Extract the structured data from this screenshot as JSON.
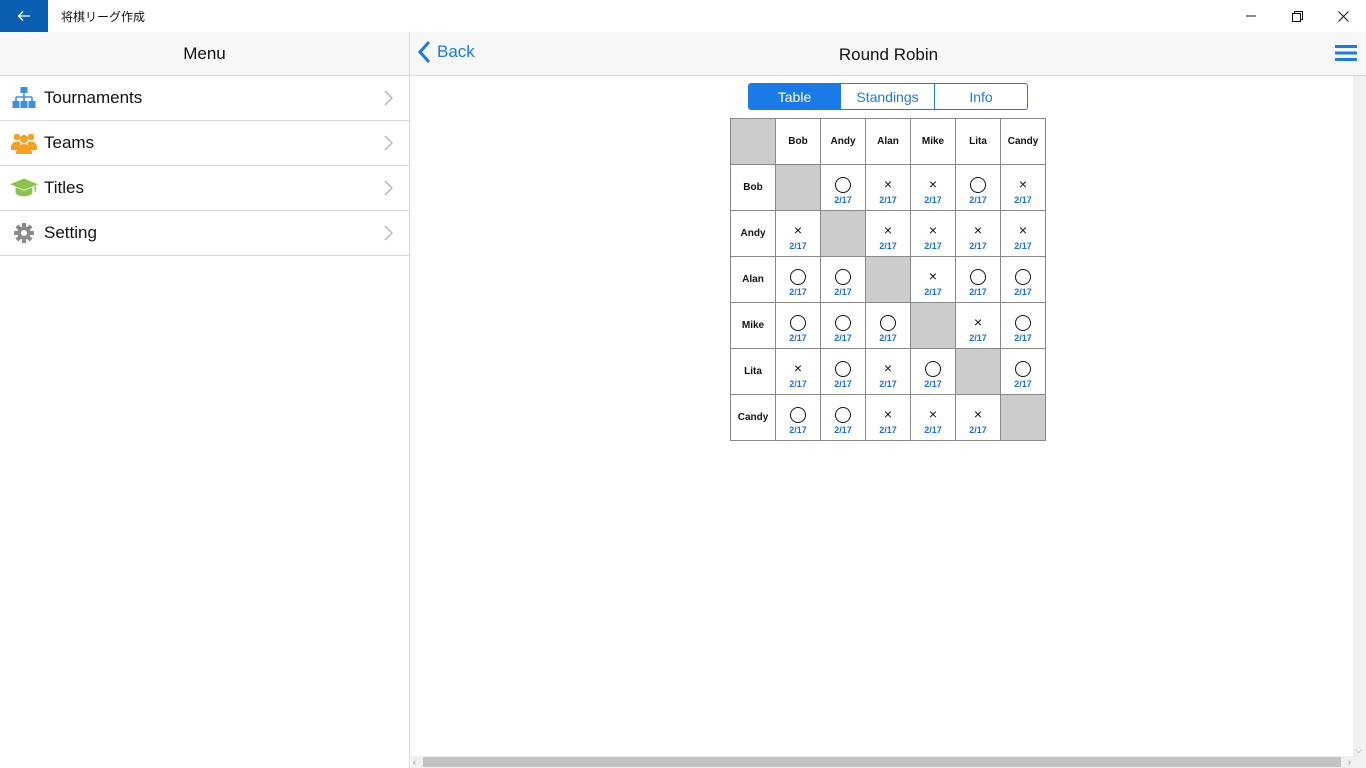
{
  "window": {
    "title": "将棋リーグ作成"
  },
  "menu": {
    "header": "Menu",
    "items": [
      {
        "label": "Tournaments",
        "icon": "org-chart-icon",
        "color": "#3d8fe0"
      },
      {
        "label": "Teams",
        "icon": "people-icon",
        "color": "#f4a023"
      },
      {
        "label": "Titles",
        "icon": "graduation-cap-icon",
        "color": "#8bc34a"
      },
      {
        "label": "Setting",
        "icon": "gear-icon",
        "color": "#8a8a8a"
      }
    ]
  },
  "nav": {
    "back_label": "Back",
    "title": "Round Robin"
  },
  "tabs": [
    {
      "label": "Table",
      "active": true
    },
    {
      "label": "Standings",
      "active": false
    },
    {
      "label": "Info",
      "active": false
    }
  ],
  "table": {
    "players": [
      "Bob",
      "Andy",
      "Alan",
      "Mike",
      "Lita",
      "Candy"
    ],
    "rows": [
      [
        null,
        {
          "r": "o",
          "d": "2/17"
        },
        {
          "r": "x",
          "d": "2/17"
        },
        {
          "r": "x",
          "d": "2/17"
        },
        {
          "r": "o",
          "d": "2/17"
        },
        {
          "r": "x",
          "d": "2/17"
        }
      ],
      [
        {
          "r": "x",
          "d": "2/17"
        },
        null,
        {
          "r": "x",
          "d": "2/17"
        },
        {
          "r": "x",
          "d": "2/17"
        },
        {
          "r": "x",
          "d": "2/17"
        },
        {
          "r": "x",
          "d": "2/17"
        }
      ],
      [
        {
          "r": "o",
          "d": "2/17"
        },
        {
          "r": "o",
          "d": "2/17"
        },
        null,
        {
          "r": "x",
          "d": "2/17"
        },
        {
          "r": "o",
          "d": "2/17"
        },
        {
          "r": "o",
          "d": "2/17"
        }
      ],
      [
        {
          "r": "o",
          "d": "2/17"
        },
        {
          "r": "o",
          "d": "2/17"
        },
        {
          "r": "o",
          "d": "2/17"
        },
        null,
        {
          "r": "x",
          "d": "2/17"
        },
        {
          "r": "o",
          "d": "2/17"
        }
      ],
      [
        {
          "r": "x",
          "d": "2/17"
        },
        {
          "r": "o",
          "d": "2/17"
        },
        {
          "r": "x",
          "d": "2/17"
        },
        {
          "r": "o",
          "d": "2/17"
        },
        null,
        {
          "r": "o",
          "d": "2/17"
        }
      ],
      [
        {
          "r": "o",
          "d": "2/17"
        },
        {
          "r": "o",
          "d": "2/17"
        },
        {
          "r": "x",
          "d": "2/17"
        },
        {
          "r": "x",
          "d": "2/17"
        },
        {
          "r": "x",
          "d": "2/17"
        },
        null
      ]
    ]
  },
  "colors": {
    "accent": "#1a7be8",
    "titlebar_back": "#0a5fb4",
    "diagonal": "#cccccc",
    "date": "#1a6fd6"
  }
}
